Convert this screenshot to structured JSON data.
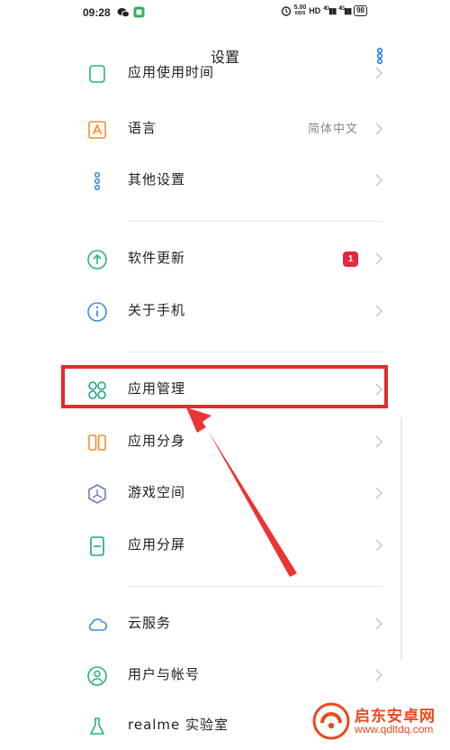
{
  "status_bar": {
    "time": "09:28",
    "net_speed_value": "5.00",
    "net_speed_unit": "KB/S",
    "hd_label": "HD",
    "signal_1": "4G",
    "signal_2": "4G",
    "battery": "98"
  },
  "header": {
    "title": "设置"
  },
  "settings": {
    "partial_top_label": "应用使用时间",
    "language": {
      "label": "语言",
      "value": "简体中文"
    },
    "other": {
      "label": "其他设置"
    },
    "update": {
      "label": "软件更新",
      "badge": "1"
    },
    "about": {
      "label": "关于手机"
    },
    "app_manage": {
      "label": "应用管理"
    },
    "app_clone": {
      "label": "应用分身"
    },
    "game_space": {
      "label": "游戏空间"
    },
    "split_screen": {
      "label": "应用分屏"
    },
    "cloud": {
      "label": "云服务"
    },
    "accounts": {
      "label": "用户与帐号"
    },
    "lab": {
      "label": "realme 实验室"
    }
  },
  "watermark": {
    "name": "启东安卓网",
    "url": "www.qdltdq.com"
  },
  "colors": {
    "highlight": "#e62a2a",
    "badge": "#e8263d",
    "icon_orange": "#ff8a2b",
    "icon_green": "#27b67a",
    "icon_blue": "#3a8ee6",
    "icon_teal": "#1aa58f"
  }
}
